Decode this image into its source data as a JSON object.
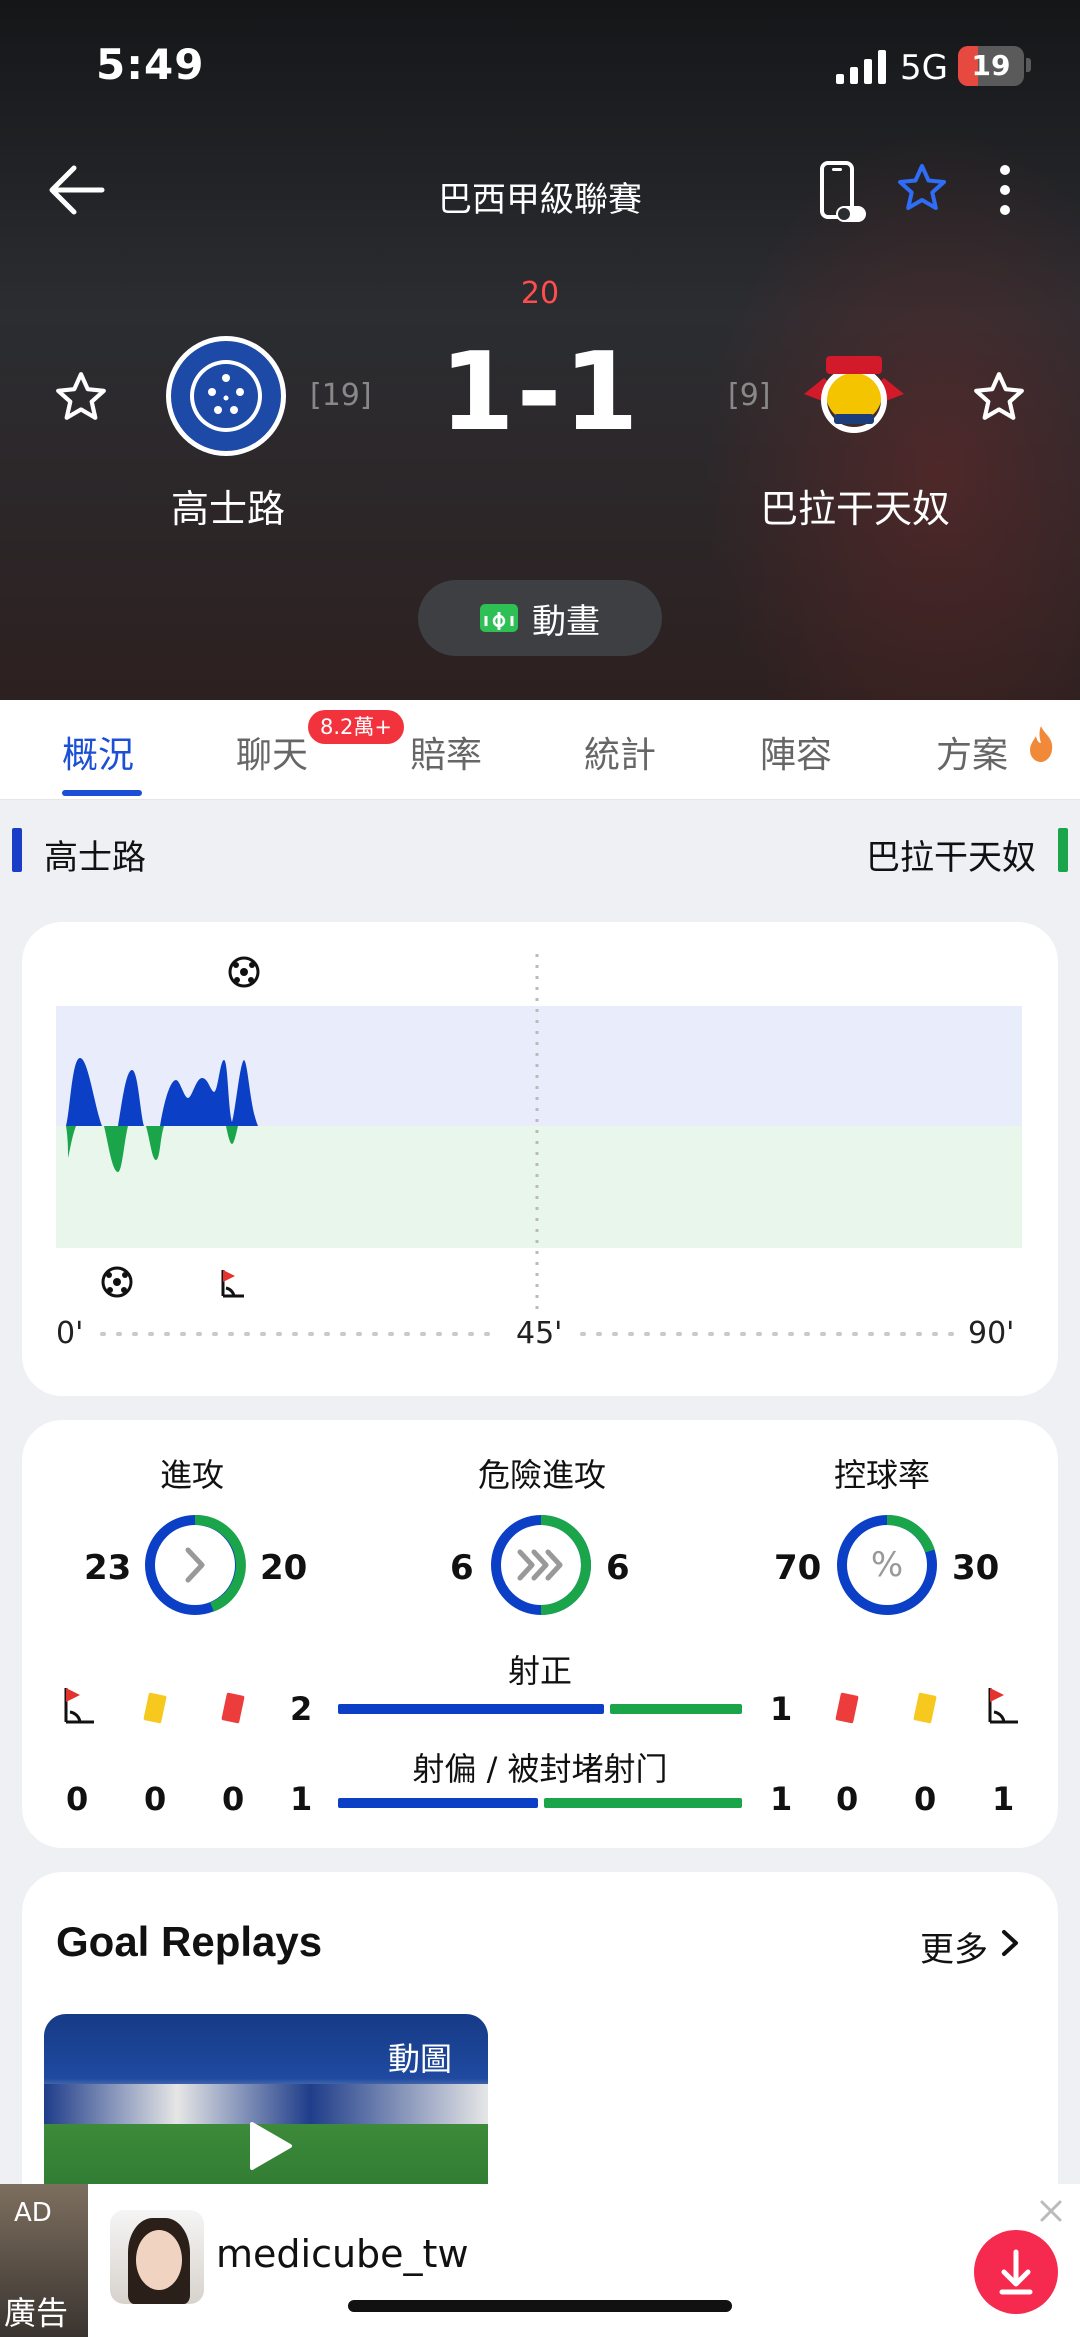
{
  "status_bar": {
    "time": "5:49",
    "network": "5G",
    "battery": "19"
  },
  "nav": {
    "league": "巴西甲級聯賽"
  },
  "match": {
    "minute": "20",
    "score": "1-1",
    "home": {
      "name": "高士路",
      "rank": "[19]"
    },
    "away": {
      "name": "巴拉干天奴",
      "rank": "[9]"
    },
    "animation_label": "動畫"
  },
  "tabs": [
    {
      "label": "概況",
      "active": true
    },
    {
      "label": "聊天",
      "badge": "8.2萬+"
    },
    {
      "label": "賠率"
    },
    {
      "label": "統計"
    },
    {
      "label": "陣容"
    },
    {
      "label": "方案"
    }
  ],
  "team_bar": {
    "home": "高士路",
    "away": "巴拉干天奴",
    "home_color": "#1a3dc8",
    "away_color": "#1aa54b"
  },
  "momentum": {
    "time_labels": [
      "0'",
      "45'",
      "90'"
    ],
    "home_events": [
      "goal-icon"
    ],
    "away_events": [
      "goal-icon",
      "corner-flag-icon"
    ],
    "home_color": "#0b3fc6",
    "away_color": "#1aa54b"
  },
  "stats": {
    "attack": {
      "label": "進攻",
      "home": "23",
      "away": "20"
    },
    "dangerous_attack": {
      "label": "危險進攻",
      "home": "6",
      "away": "6"
    },
    "possession": {
      "label": "控球率",
      "home": "70",
      "away": "30"
    },
    "shots_on": {
      "label": "射正",
      "home": "2",
      "away": "1"
    },
    "shots_off": {
      "label": "射偏 / 被封堵射门",
      "home": "1",
      "away": "1"
    },
    "home_counts": {
      "corners": "0",
      "yellow": "0",
      "red": "0"
    },
    "away_counts": {
      "red": "0",
      "yellow": "0",
      "corners": "1"
    }
  },
  "goal_replays": {
    "title": "Goal Replays",
    "more_label": "更多",
    "thumb_tag": "動圖"
  },
  "ad": {
    "tag": "AD",
    "label": "廣告",
    "name": "medicube_tw"
  }
}
